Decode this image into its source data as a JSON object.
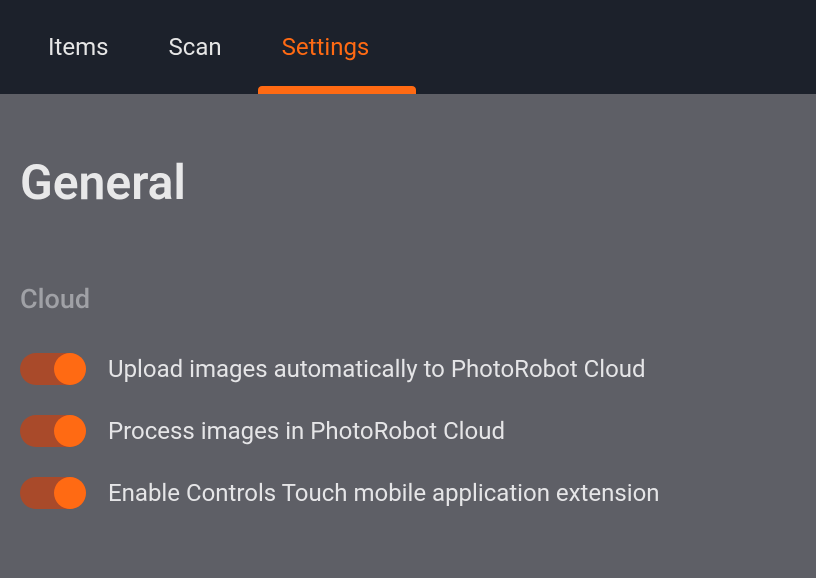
{
  "tabs": {
    "items": "Items",
    "scan": "Scan",
    "settings": "Settings"
  },
  "page": {
    "title": "General"
  },
  "cloud_section": {
    "title": "Cloud",
    "toggles": [
      {
        "label": "Upload images automatically to PhotoRobot Cloud",
        "enabled": true
      },
      {
        "label": "Process images in PhotoRobot Cloud",
        "enabled": true
      },
      {
        "label": "Enable Controls Touch mobile application extension",
        "enabled": true
      }
    ]
  },
  "colors": {
    "accent": "#ff6a13",
    "header_bg": "#1c212b",
    "content_bg": "#5e5f66"
  }
}
